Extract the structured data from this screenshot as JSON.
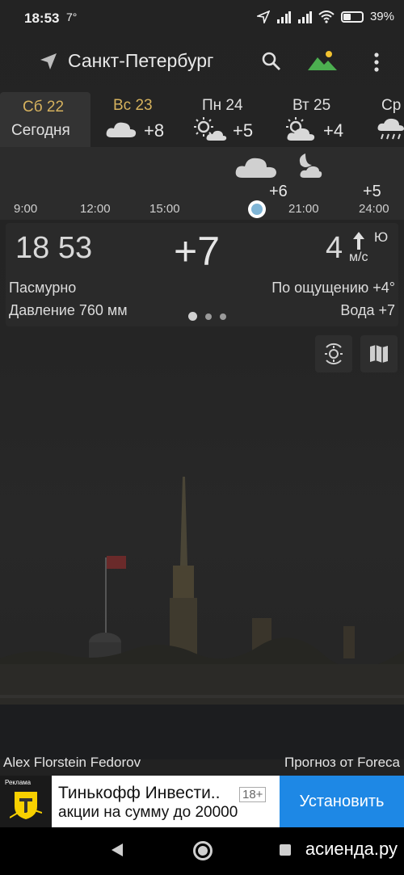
{
  "status": {
    "time": "18:53",
    "temp": "7°",
    "battery": "39%"
  },
  "header": {
    "city": "Санкт-Петербург"
  },
  "days": [
    {
      "name": "Сб 22",
      "sub": "Сегодня",
      "temp": "",
      "icon": "none",
      "active": true
    },
    {
      "name": "Вс 23",
      "temp": "+8",
      "icon": "cloud-icon"
    },
    {
      "name": "Пн 24",
      "temp": "+5",
      "icon": "partly-sunny-icon"
    },
    {
      "name": "Вт 25",
      "temp": "+4",
      "icon": "partly-sunny-icon"
    },
    {
      "name": "Ср",
      "temp": "",
      "icon": "rain-icon"
    }
  ],
  "hourly": {
    "labels": [
      "9:00",
      "12:00",
      "15:00",
      "21:00",
      "24:00"
    ],
    "temps": [
      "+6",
      "+5"
    ]
  },
  "current": {
    "time_h": "18",
    "time_m": "53",
    "temp": "+7",
    "wind_speed": "4",
    "wind_dir": "Ю",
    "wind_unit": "м/с",
    "condition": "Пасмурно",
    "feels_like": "По ощущению +4°",
    "pressure": "Давление 760 мм",
    "water": "Вода +7"
  },
  "credits": {
    "photo": "Alex Florstein Fedorov",
    "forecast": "Прогноз от Foreca"
  },
  "ad": {
    "label": "Реклама",
    "title": "Тинькофф Инвести..",
    "age": "18+",
    "subtitle": "акции на сумму до 20000",
    "button": "Установить"
  },
  "watermark": "асиенда.ру",
  "colors": {
    "accent_day": "#d6b25e",
    "now_dot": "#7fb5d6",
    "ad_button": "#1e88e5",
    "mountain_green": "#4caf50",
    "sun_yellow": "#f2c230"
  }
}
